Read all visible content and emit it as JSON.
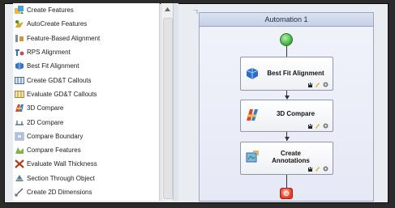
{
  "tool_list": {
    "items": [
      {
        "label": "Create Features",
        "icon": "create-features-icon"
      },
      {
        "label": "AutoCreate Features",
        "icon": "autocreate-features-icon"
      },
      {
        "label": "Feature-Based Alignment",
        "icon": "feature-alignment-icon"
      },
      {
        "label": "RPS Alignment",
        "icon": "rps-alignment-icon"
      },
      {
        "label": "Best Fit Alignment",
        "icon": "best-fit-icon"
      },
      {
        "label": "Create GD&T Callouts",
        "icon": "gdt-callouts-icon"
      },
      {
        "label": "Evaluate GD&T Callouts",
        "icon": "evaluate-gdt-icon"
      },
      {
        "label": "3D Compare",
        "icon": "3d-compare-icon"
      },
      {
        "label": "2D Compare",
        "icon": "2d-compare-icon"
      },
      {
        "label": "Compare Boundary",
        "icon": "compare-boundary-icon"
      },
      {
        "label": "Compare Features",
        "icon": "compare-features-icon"
      },
      {
        "label": "Evaluate Wall Thickness",
        "icon": "wall-thickness-icon"
      },
      {
        "label": "Section Through Object",
        "icon": "section-icon"
      },
      {
        "label": "Create 2D Dimensions",
        "icon": "2d-dimensions-icon"
      }
    ]
  },
  "automation": {
    "title": "Automation 1",
    "nodes": [
      {
        "label": "Best Fit Alignment",
        "icon": "best-fit-icon"
      },
      {
        "label": "3D Compare",
        "icon": "3d-compare-icon"
      },
      {
        "label": "Create Annotations",
        "icon": "annotations-icon"
      }
    ]
  },
  "colors": {
    "start": "#3aa83a",
    "stop": "#e33b22",
    "panel_title_bg": "#c6d1e6"
  }
}
